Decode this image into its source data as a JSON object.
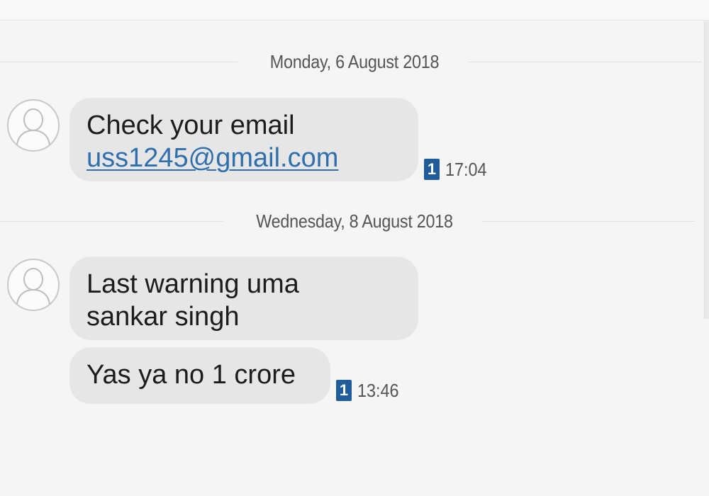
{
  "conversation": {
    "days": [
      {
        "date": "Monday, 6 August 2018",
        "messages": [
          {
            "text_line1": "Check your email",
            "link": "uss1245@gmail.com",
            "sim": "1",
            "time": "17:04"
          }
        ]
      },
      {
        "date": "Wednesday, 8 August 2018",
        "messages": [
          {
            "text_line1": "Last warning uma",
            "text_line2": "sankar singh"
          },
          {
            "text_line1": "Yas ya no 1 crore",
            "sim": "1",
            "time": "13:46"
          }
        ]
      }
    ]
  },
  "icons": {
    "avatar": "contact-avatar-icon",
    "sim": "sim-1-icon"
  },
  "colors": {
    "background": "#f5f5f5",
    "bubble": "#e6e6e6",
    "link": "#2f6fae",
    "sim_badge": "#1f5c99",
    "meta_text": "#555555"
  }
}
